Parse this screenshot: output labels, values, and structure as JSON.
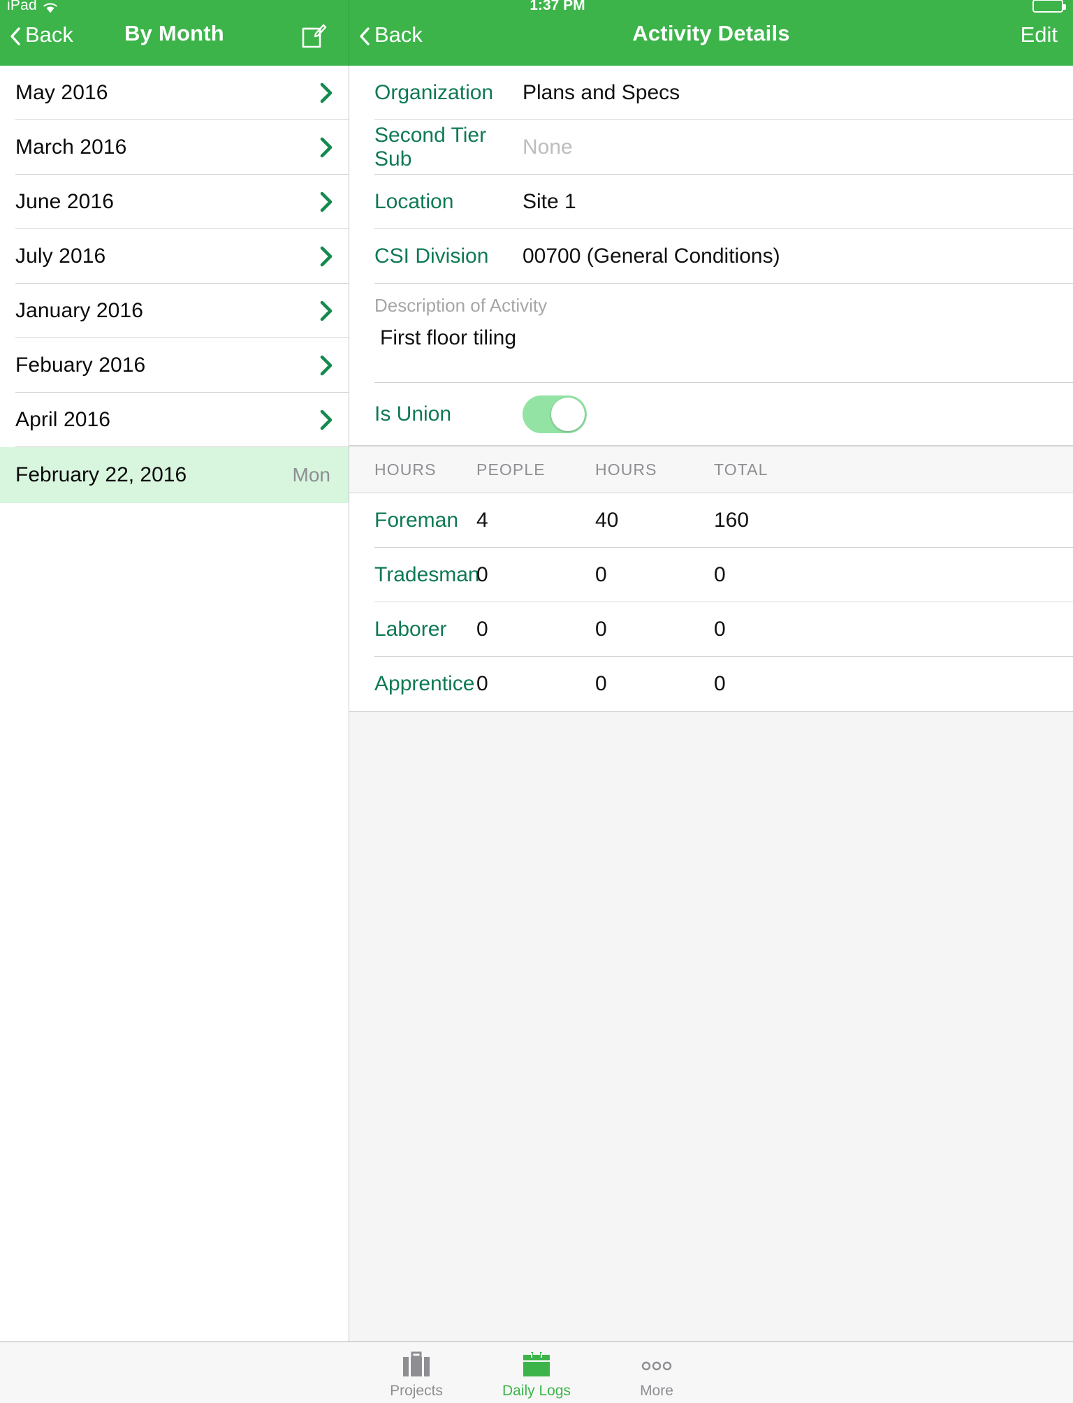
{
  "statusbar": {
    "device": "iPad",
    "wifi_icon": "wifi-icon",
    "time": "1:37 PM",
    "battery_icon": "battery-icon"
  },
  "left_nav": {
    "back_label": "Back",
    "back_icon": "chevron-left-icon",
    "title": "By Month",
    "compose_icon": "compose-icon"
  },
  "right_nav": {
    "back_label": "Back",
    "back_icon": "chevron-left-icon",
    "title": "Activity Details",
    "edit_label": "Edit"
  },
  "month_list": {
    "items": [
      {
        "label": "May 2016",
        "disclosure_icon": "chevron-right-icon"
      },
      {
        "label": "March 2016",
        "disclosure_icon": "chevron-right-icon"
      },
      {
        "label": "June 2016",
        "disclosure_icon": "chevron-right-icon"
      },
      {
        "label": "July 2016",
        "disclosure_icon": "chevron-right-icon"
      },
      {
        "label": "January 2016",
        "disclosure_icon": "chevron-right-icon"
      },
      {
        "label": "Febuary 2016",
        "disclosure_icon": "chevron-right-icon"
      },
      {
        "label": "April 2016",
        "disclosure_icon": "chevron-right-icon"
      }
    ],
    "selected_day": {
      "label": "February 22, 2016",
      "day": "Mon"
    }
  },
  "details": {
    "fields": [
      {
        "label": "Organization",
        "value": "Plans and Specs",
        "is_placeholder": false
      },
      {
        "label": "Second Tier Sub",
        "value": "None",
        "is_placeholder": true
      },
      {
        "label": "Location",
        "value": "Site 1",
        "is_placeholder": false
      },
      {
        "label": "CSI Division",
        "value": "00700 (General Conditions)",
        "is_placeholder": false
      }
    ],
    "description": {
      "label": "Description of Activity",
      "value": "First floor tiling"
    },
    "is_union": {
      "label": "Is Union",
      "value": "on"
    }
  },
  "hours_table": {
    "headers": [
      "HOURS",
      "PEOPLE",
      "HOURS",
      "TOTAL"
    ],
    "rows": [
      {
        "role": "Foreman",
        "people": "4",
        "hours": "40",
        "total": "160"
      },
      {
        "role": "Tradesman",
        "people": "0",
        "hours": "0",
        "total": "0"
      },
      {
        "role": "Laborer",
        "people": "0",
        "hours": "0",
        "total": "0"
      },
      {
        "role": "Apprentice",
        "people": "0",
        "hours": "0",
        "total": "0"
      }
    ]
  },
  "tabbar": {
    "tabs": [
      {
        "label": "Projects",
        "icon": "briefcase-icon",
        "active": false
      },
      {
        "label": "Daily Logs",
        "icon": "calendar-icon",
        "active": true
      },
      {
        "label": "More",
        "icon": "ellipsis-icon",
        "active": false
      }
    ]
  },
  "colors": {
    "brand_green": "#3cb44a",
    "label_teal": "#0f7a53",
    "selection_green": "#d8f5de",
    "toggle_on": "#93e4a4",
    "muted_gray": "#8e8e93"
  }
}
